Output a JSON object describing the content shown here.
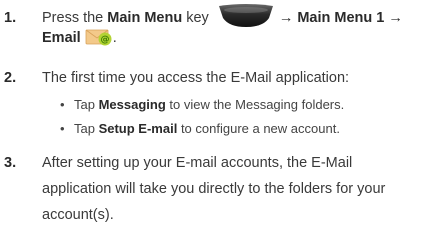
{
  "steps": [
    {
      "num": "1.",
      "parts": [
        "Press the ",
        "Main Menu",
        " key ",
        "→ Main Menu 1 →",
        "Email",
        "."
      ]
    },
    {
      "num": "2.",
      "text": "The first time you access the E-Mail application:"
    },
    {
      "num": "3.",
      "line1": "After setting up your E-mail accounts, the E-Mail",
      "line2": "application will take you directly to the folders for your",
      "line3": "account(s)."
    }
  ],
  "bullets": [
    {
      "pre": "Tap ",
      "bold": "Messaging",
      "post": " to view the Messaging folders."
    },
    {
      "pre": "Tap ",
      "bold": "Setup E-mail",
      "post": " to configure a new account."
    }
  ],
  "bullet_char": "•",
  "icons": {
    "key": "main-menu-key-icon",
    "email": "email-app-icon"
  },
  "colors": {
    "text": "#3a3a3a",
    "key_dark": "#1c1c1c",
    "email_green": "#b3d334",
    "email_envelope": "#f3c98a"
  }
}
